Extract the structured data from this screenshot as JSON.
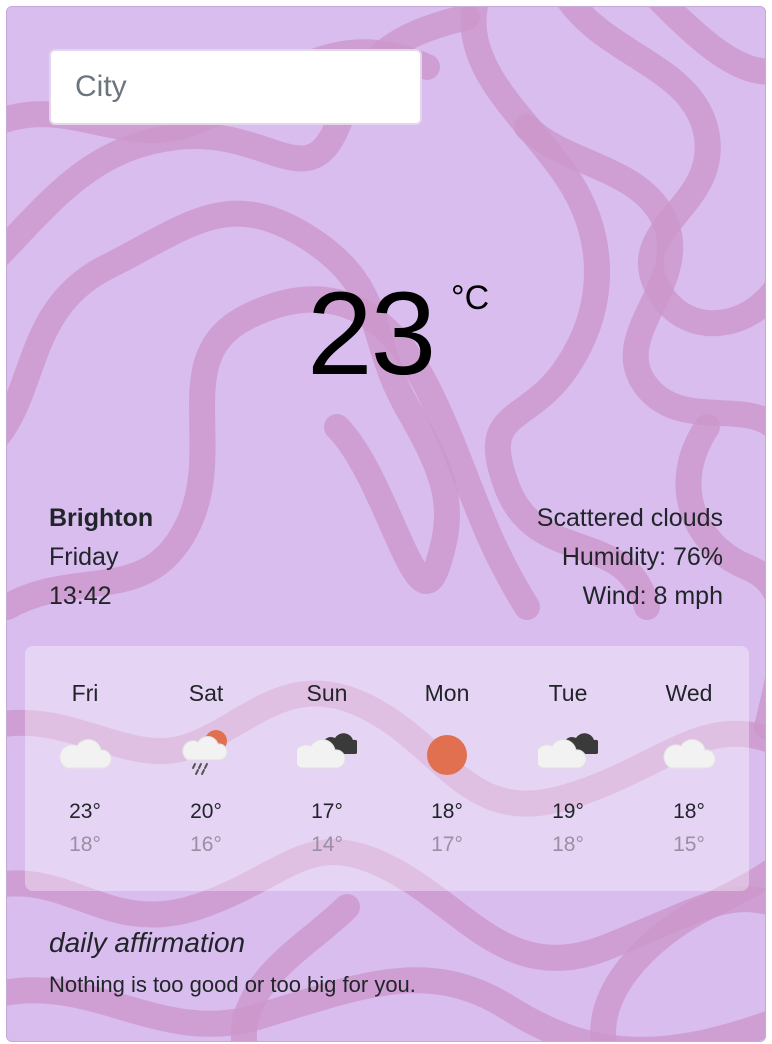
{
  "search": {
    "placeholder": "City",
    "value": ""
  },
  "current": {
    "temperature": "23",
    "unit": "°C",
    "city": "Brighton",
    "day": "Friday",
    "time": "13:42",
    "description": "Scattered clouds",
    "humidity": "Humidity: 76%",
    "wind": "Wind: 8 mph"
  },
  "forecast": [
    {
      "day": "Fri",
      "icon": "cloud-icon",
      "max": "23°",
      "min": "18°"
    },
    {
      "day": "Sat",
      "icon": "sun-rain-cloud-icon",
      "max": "20°",
      "min": "16°"
    },
    {
      "day": "Sun",
      "icon": "dark-clouds-icon",
      "max": "17°",
      "min": "14°"
    },
    {
      "day": "Mon",
      "icon": "sun-icon",
      "max": "18°",
      "min": "17°"
    },
    {
      "day": "Tue",
      "icon": "dark-clouds-icon",
      "max": "19°",
      "min": "18°"
    },
    {
      "day": "Wed",
      "icon": "cloud-icon",
      "max": "18°",
      "min": "15°"
    }
  ],
  "affirmation": {
    "title": "daily affirmation",
    "text": "Nothing is too good or too big for you."
  },
  "colors": {
    "background": "#d8bdee",
    "swirl": "#cc96c9",
    "sun": "#e07050",
    "cloud": "#f0f0f0",
    "dark_cloud": "#3a3a3a"
  }
}
